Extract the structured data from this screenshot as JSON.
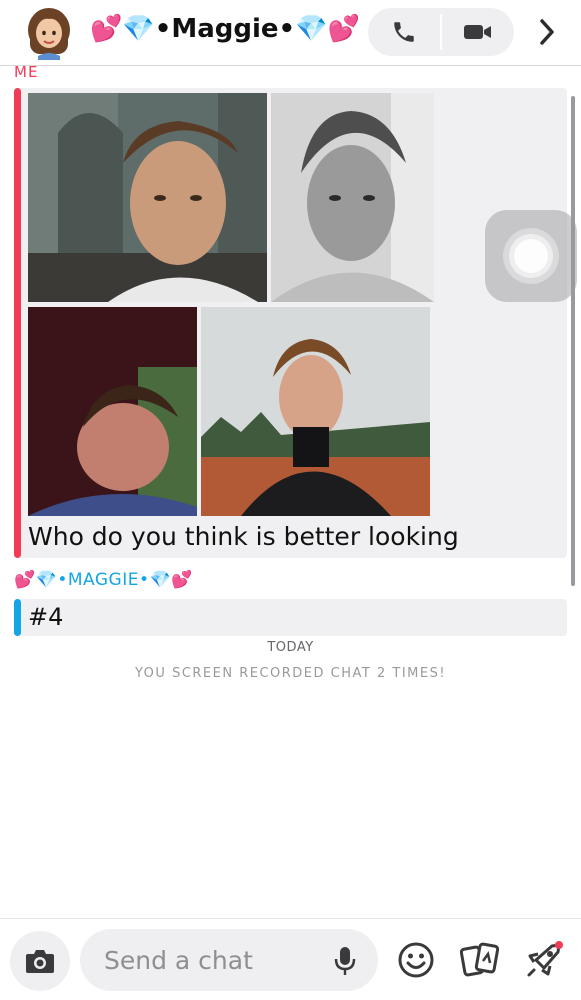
{
  "header": {
    "title": "💕💎•Maggie•💎💕",
    "icons": {
      "avatar": "bitmoji-avatar",
      "call": "phone-icon",
      "video": "video-camera-icon",
      "more": "chevron-right-icon"
    }
  },
  "conversation": {
    "me_label": "ME",
    "me_message": {
      "photos": [
        "photo-1",
        "photo-2",
        "photo-3",
        "photo-4"
      ],
      "text": "Who do you think is better looking"
    },
    "friend_label": "💕💎•MAGGIE•💎💕",
    "friend_message": {
      "text": "#4"
    },
    "date_label": "TODAY",
    "system_notice": "YOU SCREEN RECORDED CHAT 2 TIMES!"
  },
  "composer": {
    "placeholder": "Send a chat",
    "icons": {
      "camera": "camera-icon",
      "mic": "microphone-icon",
      "smiley": "smiley-icon",
      "cards": "cards-icon",
      "rocket": "rocket-icon"
    },
    "notification_dot_color": "#f23c57"
  },
  "colors": {
    "me_accent": "#f23c57",
    "friend_accent": "#14a5e6",
    "bubble_bg": "#f0f0f2"
  }
}
